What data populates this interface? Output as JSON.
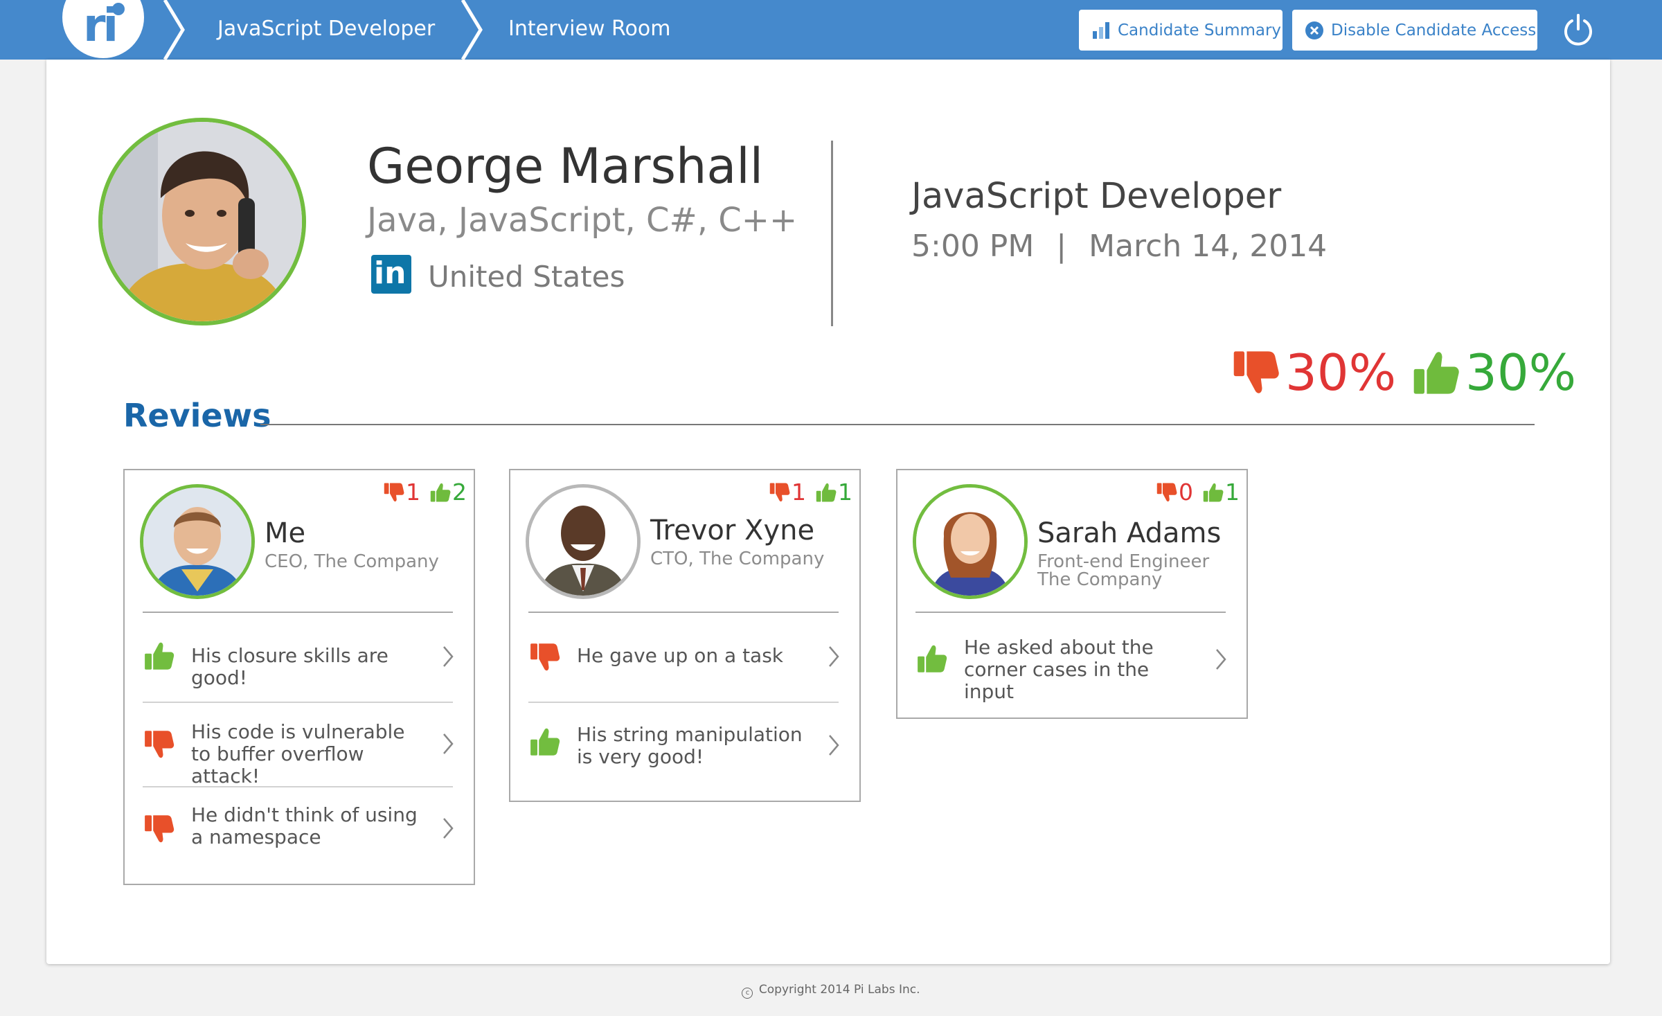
{
  "header": {
    "logo_text": "ri",
    "breadcrumbs": [
      {
        "label": "JavaScript Developer"
      },
      {
        "label": "Interview Room"
      }
    ],
    "candidate_summary_label": "Candidate Summary",
    "disable_access_label": "Disable Candidate Access",
    "accent_color": "#4589cc"
  },
  "candidate": {
    "name": "George Marshall",
    "skills": "Java, JavaScript, C#, C++",
    "linkedin_label": "in",
    "location": "United States"
  },
  "job": {
    "title": "JavaScript Developer",
    "time": "5:00 PM",
    "separator": "|",
    "date": "March 14, 2014"
  },
  "score": {
    "thumbs_down_percent": "30%",
    "thumbs_up_percent": "30%",
    "down_color": "#e03535",
    "up_color": "#36a93a"
  },
  "reviews": {
    "heading": "Reviews",
    "cards": [
      {
        "name": "Me",
        "role": "CEO, The Company",
        "down": "1",
        "up": "2",
        "items": [
          {
            "type": "up",
            "text": "His closure skills are good!"
          },
          {
            "type": "down",
            "text": "His code is vulnerable to buffer overflow attack!"
          },
          {
            "type": "down",
            "text": "He didn't think of using a namespace"
          }
        ]
      },
      {
        "name": "Trevor Xyne",
        "role": "CTO, The Company",
        "down": "1",
        "up": "1",
        "items": [
          {
            "type": "down",
            "text": "He gave up on a task"
          },
          {
            "type": "up",
            "text": "His string manipulation is very good!"
          }
        ]
      },
      {
        "name": "Sarah Adams",
        "role": "Front-end Engineer",
        "role2": "The Company",
        "down": "0",
        "up": "1",
        "items": [
          {
            "type": "up",
            "text": "He asked about the corner cases in the input"
          }
        ]
      }
    ]
  },
  "footer": {
    "copyright": "Copyright 2014 Pi Labs Inc."
  },
  "icons": {
    "thumbs_up": "thumbs-up-icon",
    "thumbs_down": "thumbs-down-icon",
    "chevron": "chevron-right-icon",
    "power": "power-icon",
    "chart": "bar-chart-icon",
    "close": "close-circle-icon"
  }
}
